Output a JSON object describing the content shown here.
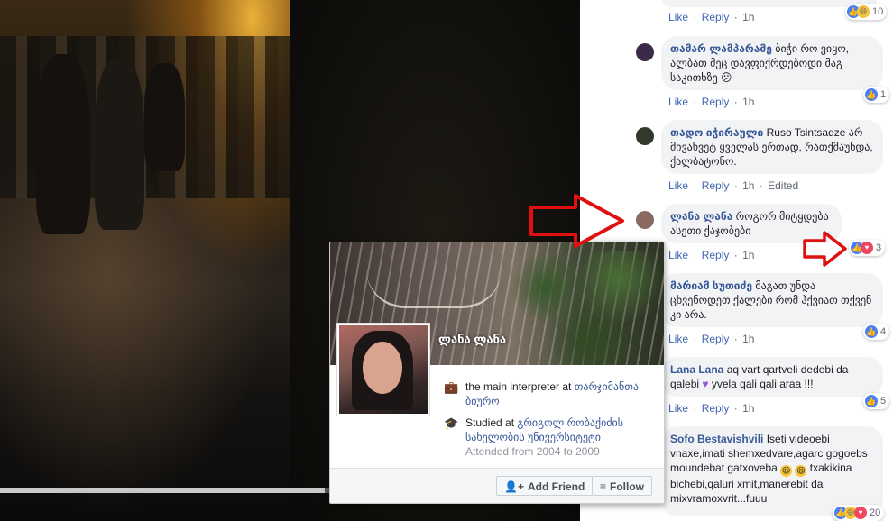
{
  "video": {
    "label": "video-player"
  },
  "comments": [
    {
      "author": "",
      "text": "",
      "actions": {
        "like": "Like",
        "reply": "Reply",
        "time": "1h",
        "edited": ""
      },
      "reactions": {
        "count": "10"
      }
    },
    {
      "author": "თამარ ლამპარამე",
      "text": " ბიჭი რო ვიყო, ალბათ მეც დავფიქრდებოდი მაგ საკითხზე 😕",
      "actions": {
        "like": "Like",
        "reply": "Reply",
        "time": "1h",
        "edited": ""
      },
      "reactions": {
        "count": "1"
      }
    },
    {
      "author": "თადო იჭირაული",
      "text": " Ruso Tsintsadze არ მივახვეტ ყველას ერთად, რათქმაუნდა, ქალბატონო.",
      "actions": {
        "like": "Like",
        "reply": "Reply",
        "time": "1h",
        "edited": "Edited"
      },
      "reactions": {
        "count": ""
      }
    },
    {
      "author": "ლანა ლანა",
      "text": " როგორ მიტყდება ასეთი ქაჯობები",
      "actions": {
        "like": "Like",
        "reply": "Reply",
        "time": "1h",
        "edited": ""
      },
      "reactions": {
        "count": "3"
      }
    },
    {
      "author": "მარიამ სუთიძე",
      "text": " მაგათ უნდა ცხვენოდეთ ქალები რომ ჰქვიათ თქვენ კი არა.",
      "actions": {
        "like": "Like",
        "reply": "Reply",
        "time": "1h",
        "edited": ""
      },
      "reactions": {
        "count": "4"
      }
    },
    {
      "author": "Lana Lana",
      "text": " aq vart qartveli dedebi da qalebi",
      "text2": " yvela qali qali araa !!!",
      "actions": {
        "like": "Like",
        "reply": "Reply",
        "time": "1h",
        "edited": ""
      },
      "reactions": {
        "count": "5"
      }
    },
    {
      "author": "Sofo Bestavishvili",
      "text": " Iseti videoebi vnaxe,imati shemxedvare,agarc gogoebs moundebat gatxoveba",
      "text2": " txakikina bichebi,qaluri xmit,manerebit da mixvramoxvrit...fuuu",
      "actions": {
        "like": "",
        "reply": "",
        "time": "",
        "edited": ""
      },
      "reactions": {
        "count": "20"
      }
    }
  ],
  "hovercard": {
    "name": "ლანა ლანა",
    "work_prefix": "the main interpreter at ",
    "work_place": "თარჯიმანთა ბიურო",
    "study_prefix": "Studied at ",
    "study_place": "გრიგოლ რობაქიძის სახელობის უნივერსიტეტი",
    "study_years": "Attended from 2004 to 2009",
    "add_friend": "Add Friend",
    "follow": "Follow"
  },
  "colors": {
    "arrow": "#e01010",
    "link": "#385898",
    "like_blue": "#4a80f5"
  }
}
